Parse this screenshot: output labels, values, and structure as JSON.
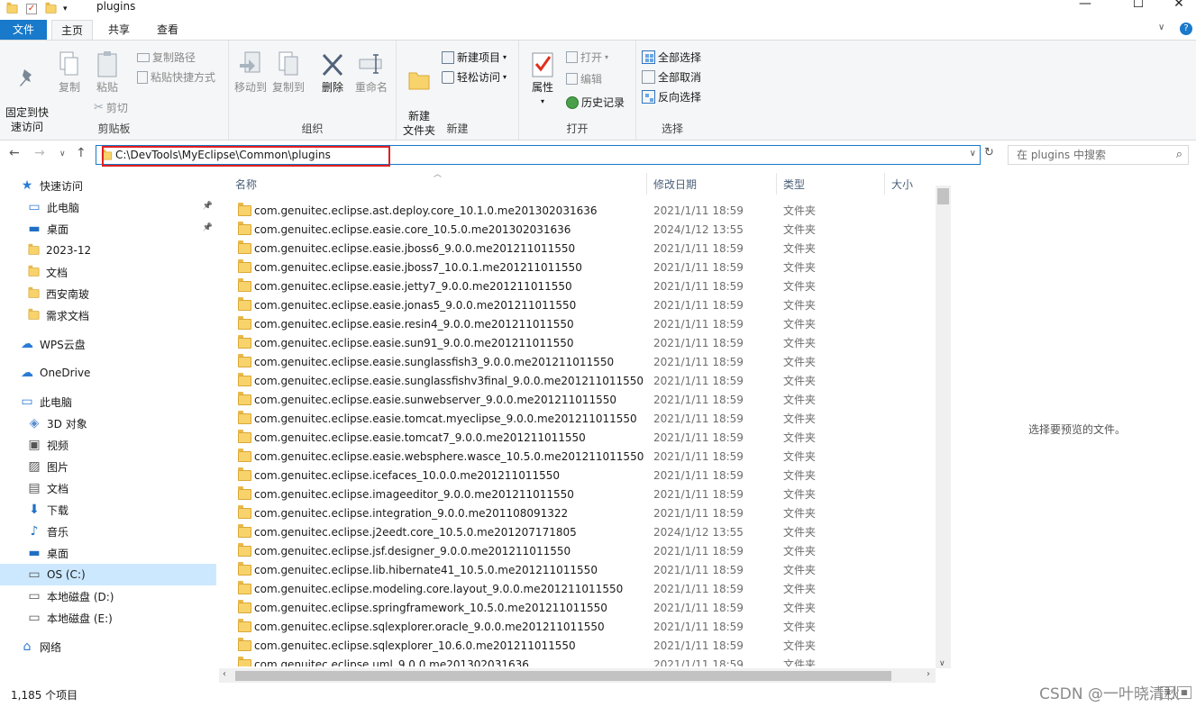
{
  "window": {
    "title": "plugins",
    "controls": {
      "minimize": "—",
      "maximize": "☐",
      "close": "✕"
    },
    "help_icon": "?"
  },
  "tabs": [
    "文件",
    "主页",
    "共享",
    "查看"
  ],
  "ribbon": {
    "clipboard": {
      "label": "剪贴板",
      "pin": "固定到快\n速访问",
      "copy": "复制",
      "paste": "粘贴",
      "copy_path": "复制路径",
      "paste_shortcut": "粘贴快捷方式",
      "cut": "剪切"
    },
    "organize": {
      "label": "组织",
      "move_to": "移动到",
      "copy_to": "复制到",
      "delete": "删除",
      "rename": "重命名"
    },
    "new": {
      "label": "新建",
      "new_folder": "新建\n文件夹",
      "new_item": "新建项目",
      "easy_access": "轻松访问"
    },
    "open": {
      "label": "打开",
      "properties": "属性",
      "open": "打开",
      "edit": "编辑",
      "history": "历史记录"
    },
    "select": {
      "label": "选择",
      "select_all": "全部选择",
      "select_none": "全部取消",
      "invert": "反向选择"
    }
  },
  "address": {
    "path": "C:\\DevTools\\MyEclipse\\Common\\plugins",
    "search_placeholder": "在 plugins 中搜索"
  },
  "sidebar": {
    "items": [
      {
        "label": "快速访问",
        "icon": "star-icon"
      },
      {
        "label": "此电脑",
        "icon": "monitor-icon"
      },
      {
        "label": "桌面",
        "icon": "desktop-icon"
      },
      {
        "label": "2023-12",
        "icon": "folder-icon"
      },
      {
        "label": "文档",
        "icon": "folder-icon"
      },
      {
        "label": "西安南玻",
        "icon": "folder-icon"
      },
      {
        "label": "需求文档",
        "icon": "folder-icon"
      },
      {
        "label": "WPS云盘",
        "icon": "cloud-icon"
      },
      {
        "label": "OneDrive",
        "icon": "cloud-icon"
      },
      {
        "label": "此电脑",
        "icon": "monitor-icon"
      },
      {
        "label": "3D 对象",
        "icon": "cube-icon"
      },
      {
        "label": "视频",
        "icon": "video-icon"
      },
      {
        "label": "图片",
        "icon": "picture-icon"
      },
      {
        "label": "文档",
        "icon": "document-icon"
      },
      {
        "label": "下载",
        "icon": "download-icon"
      },
      {
        "label": "音乐",
        "icon": "music-icon"
      },
      {
        "label": "桌面",
        "icon": "desktop-icon"
      },
      {
        "label": "OS (C:)",
        "icon": "drive-icon"
      },
      {
        "label": "本地磁盘 (D:)",
        "icon": "drive-icon"
      },
      {
        "label": "本地磁盘 (E:)",
        "icon": "drive-icon"
      },
      {
        "label": "网络",
        "icon": "network-icon"
      }
    ]
  },
  "columns": {
    "name": "名称",
    "date": "修改日期",
    "type": "类型",
    "size": "大小"
  },
  "files": [
    {
      "name": "com.genuitec.eclipse.ast.deploy.core_10.1.0.me201302031636",
      "date": "2021/1/11 18:59",
      "type": "文件夹"
    },
    {
      "name": "com.genuitec.eclipse.easie.core_10.5.0.me201302031636",
      "date": "2024/1/12 13:55",
      "type": "文件夹"
    },
    {
      "name": "com.genuitec.eclipse.easie.jboss6_9.0.0.me201211011550",
      "date": "2021/1/11 18:59",
      "type": "文件夹"
    },
    {
      "name": "com.genuitec.eclipse.easie.jboss7_10.0.1.me201211011550",
      "date": "2021/1/11 18:59",
      "type": "文件夹"
    },
    {
      "name": "com.genuitec.eclipse.easie.jetty7_9.0.0.me201211011550",
      "date": "2021/1/11 18:59",
      "type": "文件夹"
    },
    {
      "name": "com.genuitec.eclipse.easie.jonas5_9.0.0.me201211011550",
      "date": "2021/1/11 18:59",
      "type": "文件夹"
    },
    {
      "name": "com.genuitec.eclipse.easie.resin4_9.0.0.me201211011550",
      "date": "2021/1/11 18:59",
      "type": "文件夹"
    },
    {
      "name": "com.genuitec.eclipse.easie.sun91_9.0.0.me201211011550",
      "date": "2021/1/11 18:59",
      "type": "文件夹"
    },
    {
      "name": "com.genuitec.eclipse.easie.sunglassfish3_9.0.0.me201211011550",
      "date": "2021/1/11 18:59",
      "type": "文件夹"
    },
    {
      "name": "com.genuitec.eclipse.easie.sunglassfishv3final_9.0.0.me201211011550",
      "date": "2021/1/11 18:59",
      "type": "文件夹"
    },
    {
      "name": "com.genuitec.eclipse.easie.sunwebserver_9.0.0.me201211011550",
      "date": "2021/1/11 18:59",
      "type": "文件夹"
    },
    {
      "name": "com.genuitec.eclipse.easie.tomcat.myeclipse_9.0.0.me201211011550",
      "date": "2021/1/11 18:59",
      "type": "文件夹"
    },
    {
      "name": "com.genuitec.eclipse.easie.tomcat7_9.0.0.me201211011550",
      "date": "2021/1/11 18:59",
      "type": "文件夹"
    },
    {
      "name": "com.genuitec.eclipse.easie.websphere.wasce_10.5.0.me201211011550",
      "date": "2021/1/11 18:59",
      "type": "文件夹"
    },
    {
      "name": "com.genuitec.eclipse.icefaces_10.0.0.me201211011550",
      "date": "2021/1/11 18:59",
      "type": "文件夹"
    },
    {
      "name": "com.genuitec.eclipse.imageeditor_9.0.0.me201211011550",
      "date": "2021/1/11 18:59",
      "type": "文件夹"
    },
    {
      "name": "com.genuitec.eclipse.integration_9.0.0.me201108091322",
      "date": "2021/1/11 18:59",
      "type": "文件夹"
    },
    {
      "name": "com.genuitec.eclipse.j2eedt.core_10.5.0.me201207171805",
      "date": "2024/1/12 13:55",
      "type": "文件夹"
    },
    {
      "name": "com.genuitec.eclipse.jsf.designer_9.0.0.me201211011550",
      "date": "2021/1/11 18:59",
      "type": "文件夹"
    },
    {
      "name": "com.genuitec.eclipse.lib.hibernate41_10.5.0.me201211011550",
      "date": "2021/1/11 18:59",
      "type": "文件夹"
    },
    {
      "name": "com.genuitec.eclipse.modeling.core.layout_9.0.0.me201211011550",
      "date": "2021/1/11 18:59",
      "type": "文件夹"
    },
    {
      "name": "com.genuitec.eclipse.springframework_10.5.0.me201211011550",
      "date": "2021/1/11 18:59",
      "type": "文件夹"
    },
    {
      "name": "com.genuitec.eclipse.sqlexplorer.oracle_9.0.0.me201211011550",
      "date": "2021/1/11 18:59",
      "type": "文件夹"
    },
    {
      "name": "com.genuitec.eclipse.sqlexplorer_10.6.0.me201211011550",
      "date": "2021/1/11 18:59",
      "type": "文件夹"
    },
    {
      "name": "com.genuitec.eclipse.uml_9.0.0.me201302031636",
      "date": "2021/1/11 18:59",
      "type": "文件夹"
    }
  ],
  "preview_text": "选择要预览的文件。",
  "status": {
    "count": "1,185 个项目"
  },
  "watermark": "CSDN @一叶晓清秋"
}
